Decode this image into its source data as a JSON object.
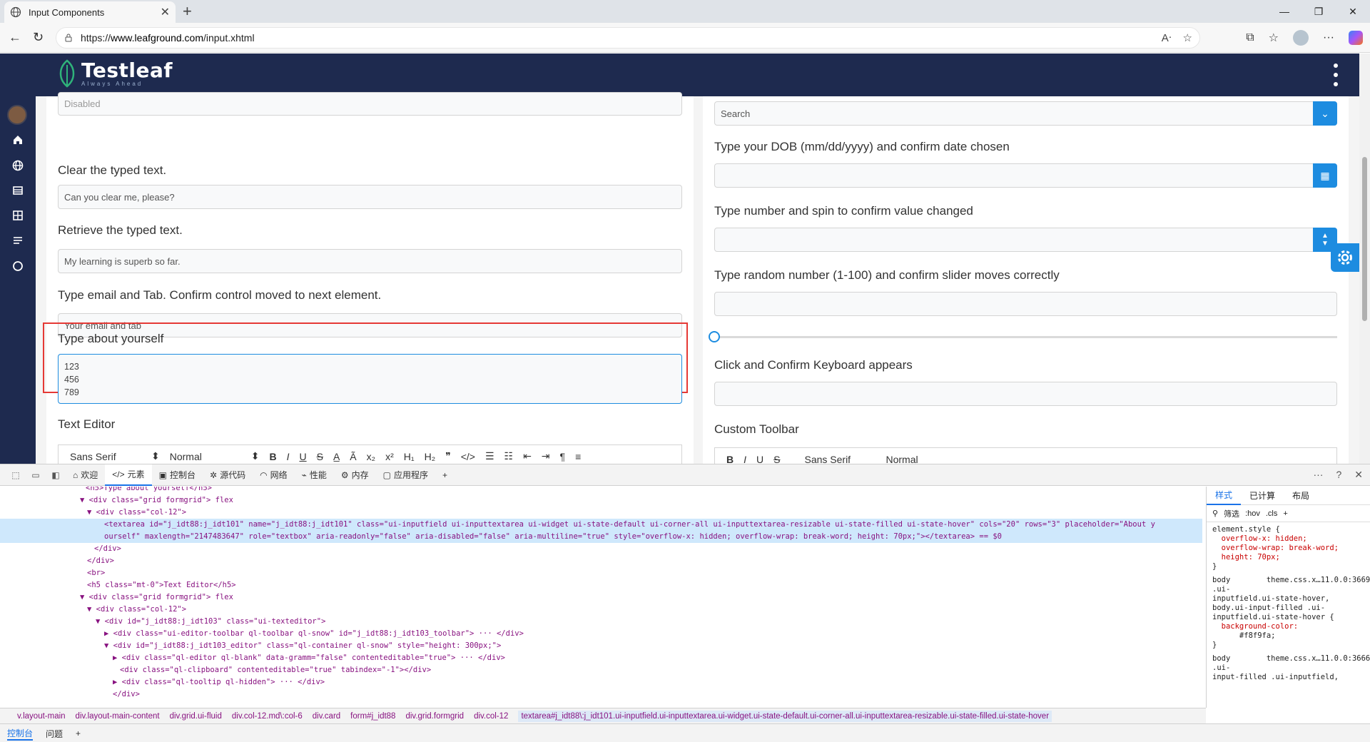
{
  "browser": {
    "tab_title": "Input Components",
    "url_prefix": "https://",
    "url_host": "www.leafground.com",
    "url_path": "/input.xhtml"
  },
  "site": {
    "logo_name": "Testleaf",
    "logo_tagline": "Always Ahead"
  },
  "left": {
    "disabled_field": "Disabled",
    "clear_label": "Clear the typed text.",
    "clear_value": "Can you clear me, please?",
    "retrieve_label": "Retrieve the typed text.",
    "retrieve_value": "My learning is superb so far.",
    "email_label": "Type email and Tab. Confirm control moved to next element.",
    "email_placeholder": "Your email and tab",
    "about_label": "Type about yourself",
    "about_value": "123\n456\n789",
    "editor_label": "Text Editor",
    "editor_font": "Sans Serif",
    "editor_size": "Normal"
  },
  "right": {
    "search_placeholder": "Search",
    "dob_label": "Type your DOB (mm/dd/yyyy) and confirm date chosen",
    "spin_label": "Type number and spin to confirm value changed",
    "slider_label": "Type random number (1-100) and confirm slider moves correctly",
    "keyboard_label": "Click and Confirm Keyboard appears",
    "custom_toolbar_label": "Custom Toolbar",
    "toolbar_font": "Sans Serif",
    "toolbar_size": "Normal"
  },
  "devtools": {
    "tabs": [
      "欢迎",
      "元素",
      "控制台",
      "源代码",
      "网络",
      "性能",
      "内存",
      "应用程序"
    ],
    "lines": [
      "<h5>Type about yourself</h5>",
      "▼ <div class=\"grid formgrid\"> flex",
      "▼ <div class=\"col-12\">",
      "<textarea id=\"j_idt88:j_idt101\" name=\"j_idt88:j_idt101\" class=\"ui-inputfield ui-inputtextarea ui-widget ui-state-default ui-corner-all ui-inputtextarea-resizable ui-state-filled ui-state-hover\" cols=\"20\" rows=\"3\" placeholder=\"About y",
      "ourself\" maxlength=\"2147483647\" role=\"textbox\" aria-readonly=\"false\" aria-disabled=\"false\" aria-multiline=\"true\" style=\"overflow-x: hidden; overflow-wrap: break-word; height: 70px;\"></textarea> == $0",
      "</div>",
      "</div>",
      "<br>",
      "<h5 class=\"mt-0\">Text Editor</h5>",
      "▼ <div class=\"grid formgrid\"> flex",
      "▼ <div class=\"col-12\">",
      "▼ <div id=\"j_idt88:j_idt103\" class=\"ui-texteditor\">",
      "▶ <div class=\"ui-editor-toolbar ql-toolbar ql-snow\" id=\"j_idt88:j_idt103_toolbar\"> ··· </div>",
      "▼ <div id=\"j_idt88:j_idt103_editor\" class=\"ql-container ql-snow\" style=\"height: 300px;\">",
      "▶ <div class=\"ql-editor ql-blank\" data-gramm=\"false\" contenteditable=\"true\"> ··· </div>",
      "<div class=\"ql-clipboard\" contenteditable=\"true\" tabindex=\"-1\"></div>",
      "▶ <div class=\"ql-tooltip ql-hidden\"> ··· </div>",
      "</div>"
    ],
    "styles_tabs": [
      "样式",
      "已计算",
      "布局"
    ],
    "styles_filter": "筛选",
    "styles_hov": ":hov",
    "styles_cls": ".cls",
    "styles_lines": [
      "element.style {",
      "  overflow-x: hidden;",
      "  overflow-wrap: break-word;",
      "  height: 70px;",
      "}",
      "body        theme.css.x…11.0.0:3669",
      ".ui-",
      "inputfield.ui-state-hover,",
      "body.ui-input-filled .ui-",
      "inputfield.ui-state-hover {",
      "  background-color:",
      "      #f8f9fa;",
      "}",
      "body        theme.css.x…11.0.0:3666",
      ".ui-",
      "input-filled .ui-inputfield,"
    ],
    "crumbs": [
      "v.layout-main",
      "div.layout-main-content",
      "div.grid.ui-fluid",
      "div.col-12.md\\:col-6",
      "div.card",
      "form#j_idt88",
      "div.grid.formgrid",
      "div.col-12",
      "textarea#j_idt88\\:j_idt101.ui-inputfield.ui-inputtextarea.ui-widget.ui-state-default.ui-corner-all.ui-inputtextarea-resizable.ui-state-filled.ui-state-hover"
    ],
    "drawer_tabs": [
      "控制台",
      "问题"
    ]
  }
}
